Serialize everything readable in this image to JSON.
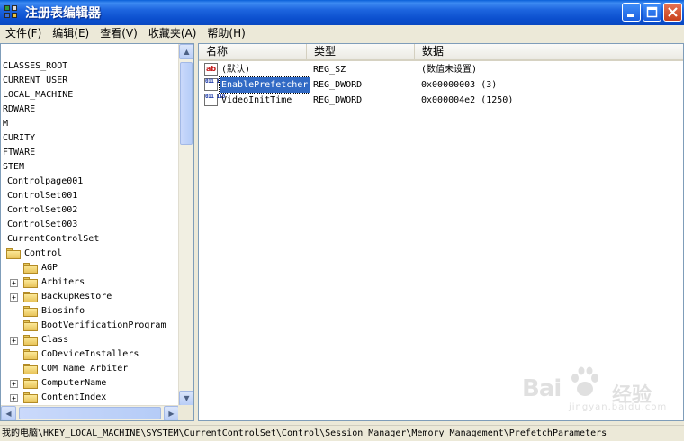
{
  "window": {
    "title": "注册表编辑器"
  },
  "menu": [
    {
      "label": "文件(F)"
    },
    {
      "label": "编辑(E)"
    },
    {
      "label": "查看(V)"
    },
    {
      "label": "收藏夹(A)"
    },
    {
      "label": "帮助(H)"
    }
  ],
  "tree": {
    "items": [
      {
        "label": "CLASSES_ROOT"
      },
      {
        "label": "CURRENT_USER"
      },
      {
        "label": "LOCAL_MACHINE"
      },
      {
        "label": "RDWARE"
      },
      {
        "label": "M"
      },
      {
        "label": "CURITY"
      },
      {
        "label": "FTWARE"
      },
      {
        "label": "STEM"
      },
      {
        "label": "Controlpage001"
      },
      {
        "label": "ControlSet001"
      },
      {
        "label": "ControlSet002"
      },
      {
        "label": "ControlSet003"
      },
      {
        "label": "CurrentControlSet"
      },
      {
        "label": "Control"
      },
      {
        "label": "AGP"
      },
      {
        "label": "Arbiters"
      },
      {
        "label": "BackupRestore"
      },
      {
        "label": "Biosinfo"
      },
      {
        "label": "BootVerificationProgram"
      },
      {
        "label": "Class"
      },
      {
        "label": "CoDeviceInstallers"
      },
      {
        "label": "COM Name Arbiter"
      },
      {
        "label": "ComputerName"
      },
      {
        "label": "ContentIndex"
      }
    ]
  },
  "list": {
    "columns": [
      {
        "label": "名称"
      },
      {
        "label": "类型"
      },
      {
        "label": "数据"
      }
    ],
    "rows": [
      {
        "name": "(默认)",
        "type": "REG_SZ",
        "data": "(数值未设置)",
        "icon": "string-value-icon",
        "icon_text": "ab"
      },
      {
        "name": "EnablePrefetcher",
        "type": "REG_DWORD",
        "data": "0x00000003 (3)",
        "icon": "dword-value-icon",
        "icon_text": "011 110",
        "selected": true
      },
      {
        "name": "VideoInitTime",
        "type": "REG_DWORD",
        "data": "0x000004e2 (1250)",
        "icon": "dword-value-icon",
        "icon_text": "011 110"
      }
    ]
  },
  "status": {
    "path": "我的电脑\\HKEY_LOCAL_MACHINE\\SYSTEM\\CurrentControlSet\\Control\\Session Manager\\Memory Management\\PrefetchParameters"
  },
  "watermark": {
    "brand": "Bai",
    "brand2": "经验",
    "sub": "jingyan.baidu.com"
  },
  "colors": {
    "titlebar": "#0a5fd8",
    "selection": "#316ac5",
    "close_button": "#c8401c"
  }
}
